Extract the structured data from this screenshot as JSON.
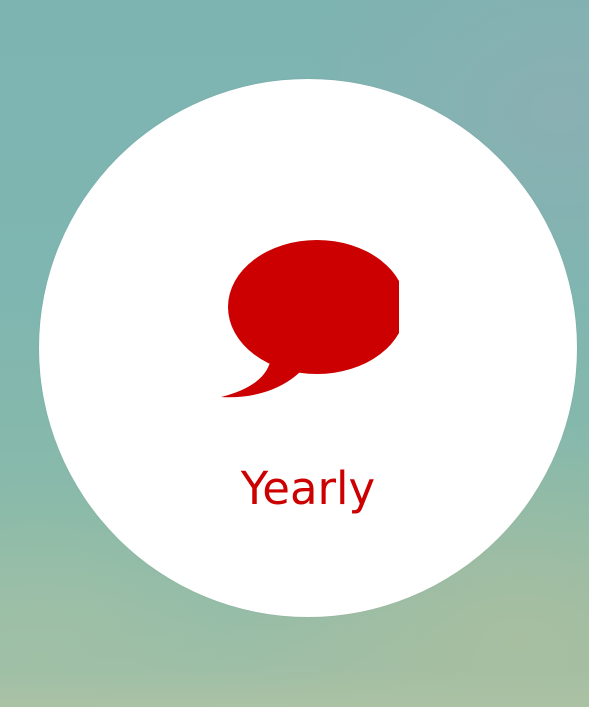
{
  "option": {
    "label": "Yearly",
    "icon": "speech-bubble-icon",
    "accent_color": "#cc0000"
  },
  "background": {
    "colors": [
      "#7db3b1",
      "#8abaa9",
      "#a3c0a6"
    ]
  }
}
